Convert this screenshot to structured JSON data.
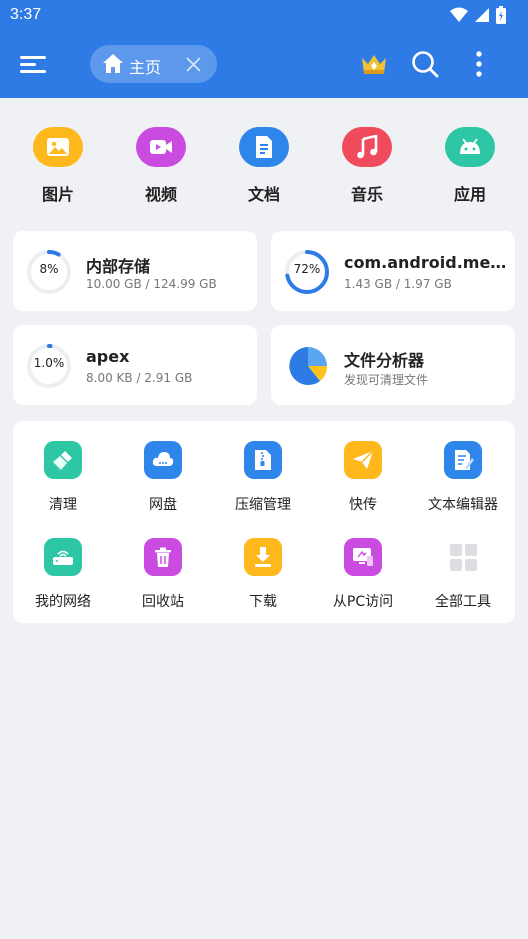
{
  "status_bar": {
    "time": "3:37"
  },
  "app_bar": {
    "tab_label": "主页"
  },
  "categories": [
    {
      "label": "图片",
      "icon": "image-icon",
      "color": "#ffb81c"
    },
    {
      "label": "视频",
      "icon": "video-icon",
      "color": "#c94be0"
    },
    {
      "label": "文档",
      "icon": "document-icon",
      "color": "#2f86ea"
    },
    {
      "label": "音乐",
      "icon": "music-icon",
      "color": "#f04a5d"
    },
    {
      "label": "应用",
      "icon": "android-icon",
      "color": "#2ec7a6"
    }
  ],
  "storage": [
    {
      "percent_label": "8%",
      "percent": 8,
      "title": "内部存储",
      "subtitle": "10.00 GB / 124.99 GB"
    },
    {
      "percent_label": "72%",
      "percent": 72,
      "title": "com.android.media.s...",
      "subtitle": "1.43 GB / 1.97 GB"
    },
    {
      "percent_label": "1.0%",
      "percent": 1,
      "title": "apex",
      "subtitle": "8.00 KB / 2.91 GB"
    }
  ],
  "analyzer": {
    "title": "文件分析器",
    "subtitle": "发现可清理文件"
  },
  "tools": [
    {
      "label": "清理",
      "icon": "broom-icon",
      "color": "#2ec7a6"
    },
    {
      "label": "网盘",
      "icon": "cloud-drive-icon",
      "color": "#2f86ea"
    },
    {
      "label": "压缩管理",
      "icon": "zip-icon",
      "color": "#2f86ea"
    },
    {
      "label": "快传",
      "icon": "paper-plane-icon",
      "color": "#ffb81c"
    },
    {
      "label": "文本编辑器",
      "icon": "text-editor-icon",
      "color": "#2f86ea"
    },
    {
      "label": "我的网络",
      "icon": "router-icon",
      "color": "#2ec7a6"
    },
    {
      "label": "回收站",
      "icon": "trash-icon",
      "color": "#c94be0"
    },
    {
      "label": "下载",
      "icon": "download-icon",
      "color": "#ffb81c"
    },
    {
      "label": "从PC访问",
      "icon": "pc-access-icon",
      "color": "#c94be0"
    },
    {
      "label": "全部工具",
      "icon": "grid-icon",
      "color": "#dddde2"
    }
  ]
}
